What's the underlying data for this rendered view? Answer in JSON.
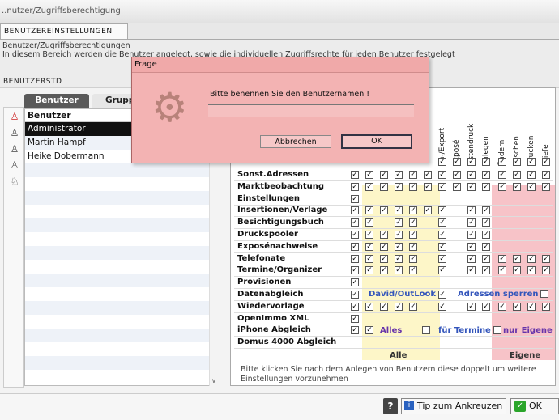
{
  "window": {
    "title": "..nutzer/Zugriffsberechtigung"
  },
  "main_tab": {
    "label": "BENUTZEREINSTELLUNGEN"
  },
  "description": {
    "line1": "Benutzer/Zugriffsberechtigungen",
    "line2": "In diesem Bereich werden die Benutzer angelegt, sowie die individuellen Zugriffsrechte für jeden Benutzer festgelegt"
  },
  "section_title": "BENUTZERSTD",
  "tabs": {
    "users": "Benutzer",
    "groups": "Gruppen"
  },
  "user_list": {
    "header": "Benutzer",
    "items": [
      "Administrator",
      "Martin Hampf",
      "Heike Dobermann"
    ],
    "selected": "Administrator"
  },
  "rights_grid": {
    "columns": [
      "Im-/Export",
      "Exposé",
      "Listendruck",
      "Anlegen",
      "Ändern",
      "Löschen",
      "Drucken",
      "Briefe"
    ],
    "rows": [
      {
        "label": "Sonst.Adressen",
        "checks": [
          1,
          1,
          1,
          1,
          1,
          1,
          1,
          1,
          1,
          1,
          1,
          1,
          1,
          1
        ]
      },
      {
        "label": "Marktbeobachtung",
        "checks": [
          1,
          1,
          1,
          1,
          1,
          1,
          1,
          1,
          1,
          1,
          1,
          1,
          1,
          1
        ]
      },
      {
        "label": "Einstellungen",
        "checks": [
          1,
          0,
          0,
          0,
          0,
          0,
          0,
          0,
          0,
          0,
          0,
          0,
          0,
          0
        ]
      },
      {
        "label": "Insertionen/Verlage",
        "checks": [
          1,
          1,
          1,
          1,
          1,
          1,
          1,
          0,
          1,
          1,
          0,
          0,
          0,
          0
        ]
      },
      {
        "label": "Besichtigungsbuch",
        "checks": [
          1,
          1,
          0,
          1,
          1,
          0,
          1,
          0,
          1,
          1,
          0,
          0,
          0,
          0
        ]
      },
      {
        "label": "Druckspooler",
        "checks": [
          1,
          1,
          1,
          1,
          1,
          0,
          1,
          0,
          1,
          1,
          0,
          0,
          0,
          0
        ]
      },
      {
        "label": "Exposénachweise",
        "checks": [
          1,
          1,
          1,
          1,
          1,
          0,
          1,
          0,
          1,
          1,
          0,
          0,
          0,
          0
        ]
      },
      {
        "label": "Telefonate",
        "checks": [
          1,
          1,
          1,
          1,
          1,
          0,
          1,
          0,
          1,
          1,
          1,
          1,
          1,
          1
        ]
      },
      {
        "label": "Termine/Organizer",
        "checks": [
          1,
          1,
          1,
          1,
          1,
          0,
          1,
          0,
          1,
          1,
          1,
          1,
          1,
          1
        ]
      },
      {
        "label": "Provisionen",
        "checks": [
          1,
          0,
          0,
          0,
          0,
          0,
          0,
          0,
          0,
          0,
          0,
          0,
          0,
          0
        ]
      },
      {
        "label": "Datenabgleich",
        "checks": [
          1,
          0,
          0,
          0,
          0,
          0,
          1,
          0,
          0,
          0,
          0,
          0,
          0,
          0
        ]
      },
      {
        "label": "Wiedervorlage",
        "checks": [
          1,
          1,
          1,
          1,
          1,
          0,
          1,
          0,
          1,
          1,
          1,
          1,
          1,
          1
        ]
      },
      {
        "label": "OpenImmo XML",
        "checks": [
          1,
          0,
          0,
          0,
          0,
          0,
          0,
          0,
          0,
          0,
          0,
          0,
          0,
          0
        ]
      },
      {
        "label": "iPhone Abgleich",
        "checks": [
          1,
          1,
          0,
          0,
          0,
          0,
          0,
          0,
          0,
          0,
          0,
          0,
          0,
          0
        ]
      },
      {
        "label": "Domus 4000 Abgleich",
        "checks": [
          0,
          0,
          0,
          0,
          0,
          0,
          0,
          0,
          0,
          0,
          0,
          0,
          0,
          0
        ]
      }
    ],
    "david_outlook": "David/OutLook",
    "addr_lock": "Adressen sperren",
    "alles": "Alles",
    "fuer_termine": "für Termine",
    "nur_eigene": "nur Eigene",
    "footer_alle": "Alle",
    "footer_eigene": "Eigene",
    "hint": "Bitte klicken Sie nach dem Anlegen von Benutzern diese doppelt um weitere Einstellungen vorzunehmen"
  },
  "dialog": {
    "title": "Frage",
    "message": "Bitte benennen Sie den Benutzernamen !",
    "input_value": "",
    "cancel": "Abbrechen",
    "ok": "OK"
  },
  "footer": {
    "help": "?",
    "tip": "Tip zum Ankreuzen",
    "ok": "OK"
  },
  "colors": {
    "dialog_bg": "#f3b3b3",
    "yellow_zone": "#fdf6c8",
    "pink_zone": "#f7c3c8",
    "selected_row": "#111111"
  }
}
